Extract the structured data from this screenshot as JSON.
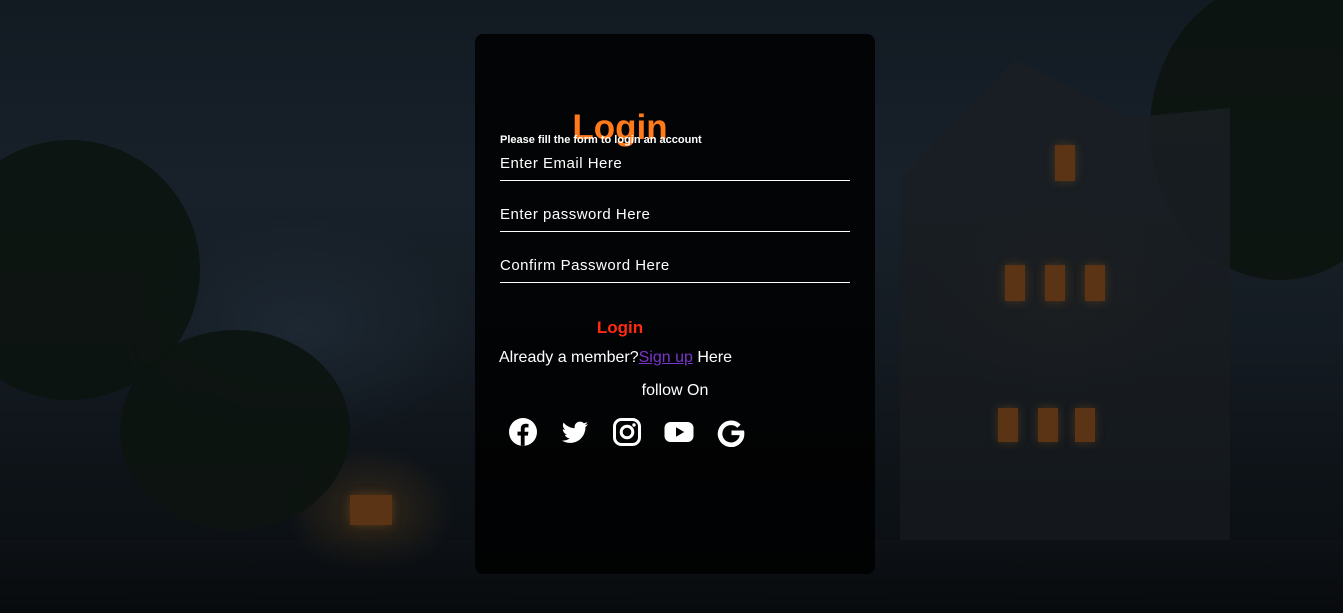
{
  "login_form": {
    "title": "Login",
    "subtitle": "Please fill the form to login an account",
    "email_placeholder": "Enter Email Here",
    "password_placeholder": "Enter password Here",
    "confirm_placeholder": "Confirm Password Here",
    "login_button_label": "Login",
    "member_prefix": "Already a member?",
    "signup_link": "Sign up",
    "member_suffix": " Here",
    "follow_label": "follow On"
  },
  "social_icons": [
    "facebook-icon",
    "twitter-icon",
    "instagram-icon",
    "youtube-icon",
    "google-icon"
  ],
  "colors": {
    "title": "#ff7a1a",
    "login_button": "#ff2a12",
    "signup_link": "#7a35c9",
    "card_background": "rgba(0,0,0,0.86)"
  }
}
